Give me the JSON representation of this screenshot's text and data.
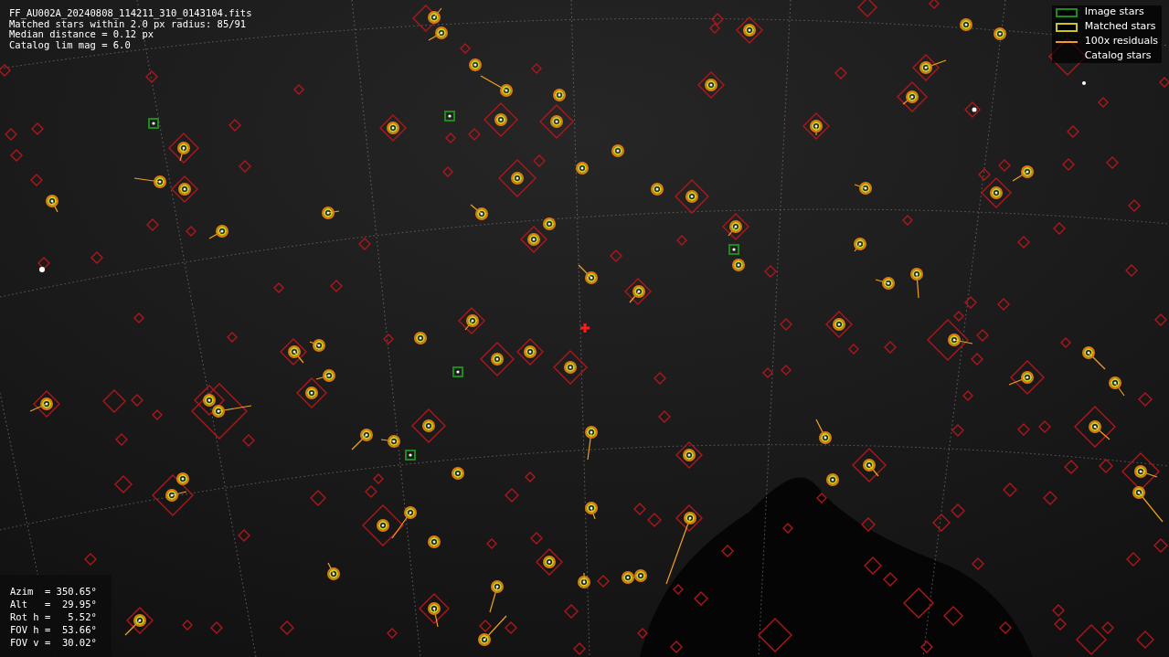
{
  "header_lines": [
    "FF_AU002A_20240808_114211_310_0143104.fits",
    "Matched stars within 2.0 px radius: 85/91",
    "Median distance = 0.12 px",
    "Catalog lim mag = 6.0"
  ],
  "legend": [
    {
      "kind": "image",
      "label": "Image stars"
    },
    {
      "kind": "matched",
      "label": "Matched stars"
    },
    {
      "kind": "residual",
      "label": "100x residuals"
    },
    {
      "kind": "catalog",
      "label": "Catalog stars"
    }
  ],
  "pointing_lines": [
    "Azim  = 350.65°",
    "Alt   =  29.95°",
    "Rot h =   5.52°",
    "FOV h =  53.66°",
    "FOV v =  30.02°"
  ]
}
